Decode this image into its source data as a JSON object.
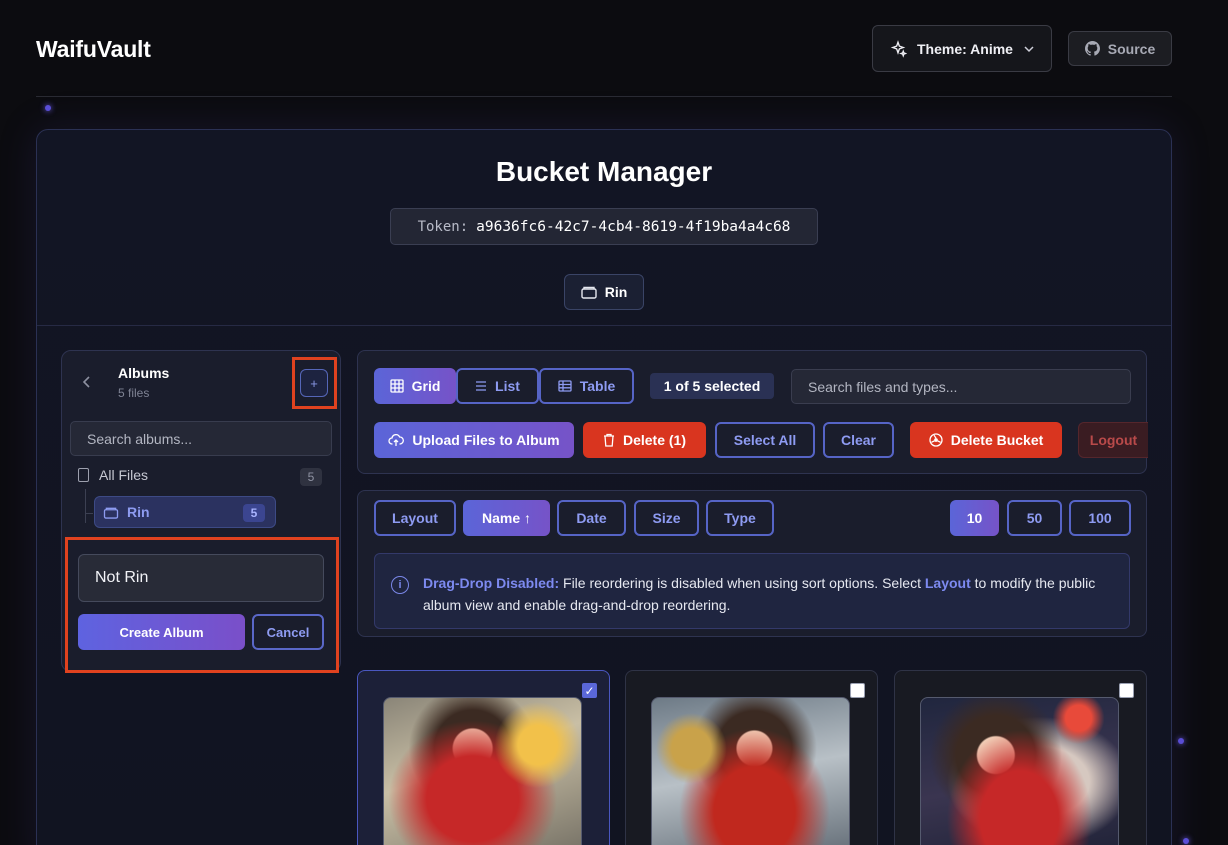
{
  "header": {
    "brand": "WaifuVault",
    "theme_label": "Theme: Anime",
    "source_label": "Source"
  },
  "main": {
    "title": "Bucket Manager",
    "token_label": "Token:",
    "token_value": "a9636fc6-42c7-4cb4-8619-4f19ba4a4c68",
    "current_album": "Rin"
  },
  "sidebar": {
    "title": "Albums",
    "subtitle": "5 files",
    "search_placeholder": "Search albums...",
    "all_files_label": "All Files",
    "all_files_count": "5",
    "albums": [
      {
        "name": "Rin",
        "count": "5"
      }
    ],
    "new_album_value": "Not Rin",
    "create_label": "Create Album",
    "cancel_label": "Cancel"
  },
  "toolbar": {
    "views": [
      "Grid",
      "List",
      "Table"
    ],
    "active_view": "Grid",
    "selection": "1 of 5 selected",
    "search_placeholder": "Search files and types...",
    "upload_label": "Upload Files to Album",
    "delete_label": "Delete (1)",
    "select_all_label": "Select All",
    "clear_label": "Clear",
    "delete_bucket_label": "Delete Bucket",
    "logout_label": "Logout"
  },
  "sort": {
    "layout_label": "Layout",
    "name_label": "Name ↑",
    "date_label": "Date",
    "size_label": "Size",
    "type_label": "Type",
    "page_sizes": [
      "10",
      "50",
      "100"
    ],
    "active_page_size": "10"
  },
  "info": {
    "heading": "Drag-Drop Disabled:",
    "text_1": " File reordering is disabled when using sort options. Select ",
    "link": "Layout",
    "text_2": " to modify the public album view and enable drag-and-drop reordering."
  },
  "files": [
    {
      "selected": true
    },
    {
      "selected": false
    },
    {
      "selected": false
    }
  ],
  "colors": {
    "accent": "#5b65d8",
    "danger": "#d9351f",
    "highlight_outline": "#e0421f"
  }
}
